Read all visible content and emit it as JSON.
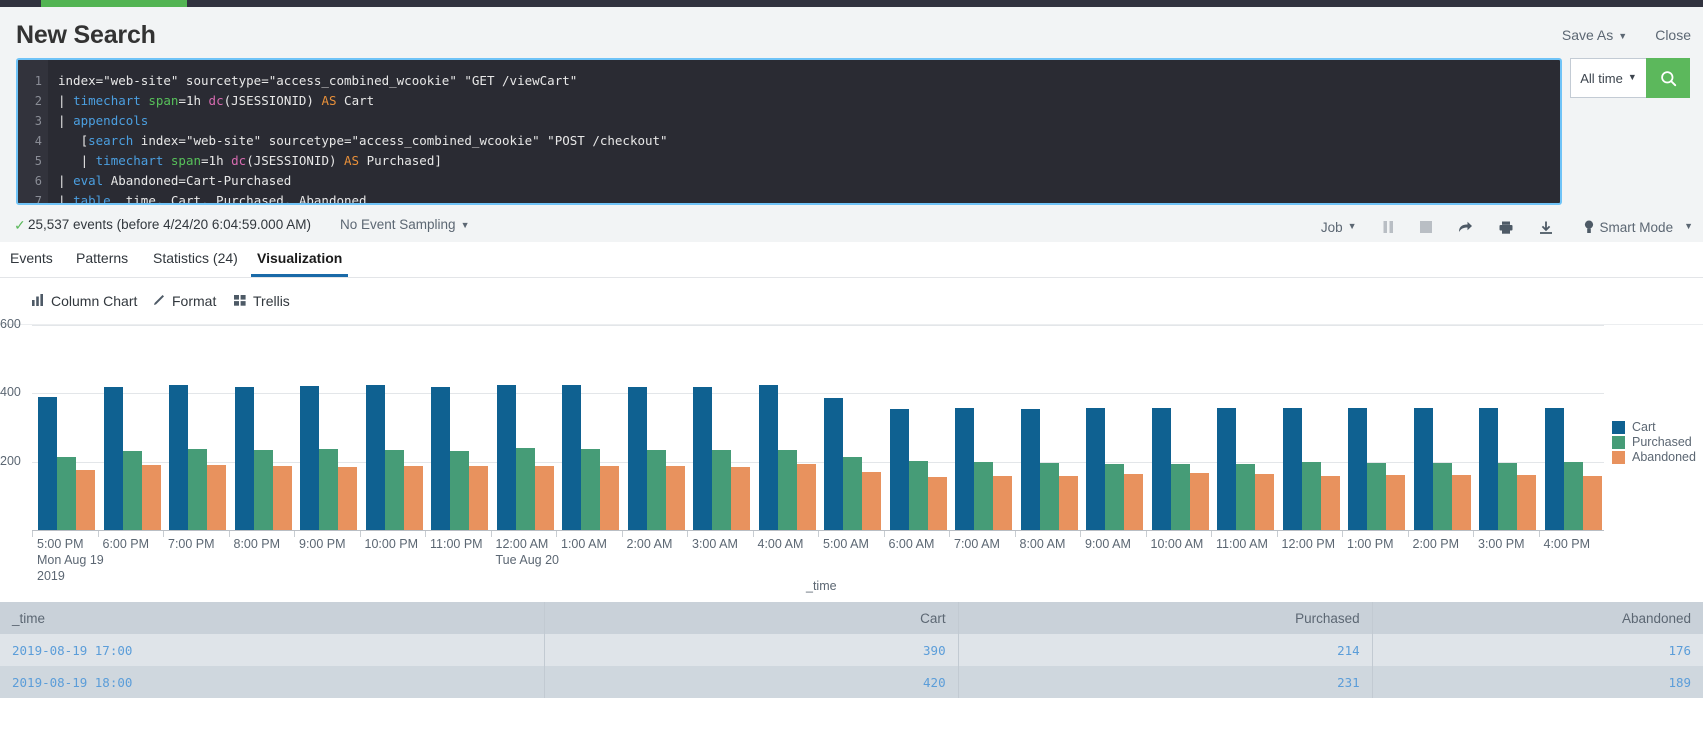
{
  "topbar": {
    "accent_color": "#53b453",
    "bar_color": "#31333f"
  },
  "header": {
    "title": "New Search",
    "save_as": "Save As",
    "close": "Close"
  },
  "search": {
    "time_range": "All time",
    "search_icon": "search-icon",
    "query_lines": [
      {
        "num": "1",
        "text": "index=\"web-site\" sourcetype=\"access_combined_wcookie\" \"GET /viewCart\""
      },
      {
        "num": "2",
        "text": "| timechart span=1h dc(JSESSIONID) AS Cart"
      },
      {
        "num": "3",
        "text": "| appendcols"
      },
      {
        "num": "4",
        "text": "   [search index=\"web-site\" sourcetype=\"access_combined_wcookie\" \"POST /checkout\""
      },
      {
        "num": "5",
        "text": "   | timechart span=1h dc(JSESSIONID) AS Purchased]"
      },
      {
        "num": "6",
        "text": "| eval Abandoned=Cart-Purchased"
      },
      {
        "num": "7",
        "text": "| table _time, Cart, Purchased, Abandoned"
      }
    ]
  },
  "status": {
    "check_icon": "checkmark-icon",
    "events_text": "25,537 events (before 4/24/20 6:04:59.000 AM)",
    "event_sampling": "No Event Sampling",
    "job": "Job",
    "pause_icon": "pause-icon",
    "stop_icon": "stop-icon",
    "share_icon": "share-icon",
    "print_icon": "print-icon",
    "export_icon": "export-icon",
    "mode_icon": "lightbulb-icon",
    "smart_mode": "Smart Mode"
  },
  "tabs": [
    {
      "label": "Events",
      "active": false
    },
    {
      "label": "Patterns",
      "active": false
    },
    {
      "label": "Statistics (24)",
      "active": false
    },
    {
      "label": "Visualization",
      "active": true
    }
  ],
  "viz_toolbar": [
    {
      "label": "Column Chart",
      "icon": "bar-chart-icon"
    },
    {
      "label": "Format",
      "icon": "pencil-icon"
    },
    {
      "label": "Trellis",
      "icon": "grid-icon"
    }
  ],
  "chart_data": {
    "type": "bar",
    "title": "",
    "xlabel": "_time",
    "ylabel": "",
    "ylim": [
      0,
      600
    ],
    "yticks": [
      200,
      400,
      600
    ],
    "grid": true,
    "legend_position": "right",
    "colors": {
      "Cart": "#0f6191",
      "Purchased": "#469c77",
      "Abandoned": "#e8925e"
    },
    "x_axis_notes": [
      {
        "index": 0,
        "line1": "Mon Aug 19",
        "line2": "2019"
      },
      {
        "index": 7,
        "line1": "Tue Aug 20",
        "line2": ""
      }
    ],
    "categories": [
      "5:00 PM",
      "6:00 PM",
      "7:00 PM",
      "8:00 PM",
      "9:00 PM",
      "10:00 PM",
      "11:00 PM",
      "12:00 AM",
      "1:00 AM",
      "2:00 AM",
      "3:00 AM",
      "4:00 AM",
      "5:00 AM",
      "6:00 AM",
      "7:00 AM",
      "8:00 AM",
      "9:00 AM",
      "10:00 AM",
      "11:00 AM",
      "12:00 PM",
      "1:00 PM",
      "2:00 PM",
      "3:00 PM",
      "4:00 PM"
    ],
    "series": [
      {
        "name": "Cart",
        "values": [
          390,
          420,
          423,
          420,
          421,
          423,
          418,
          425,
          423,
          420,
          420,
          425,
          385,
          355,
          357,
          353,
          357,
          358,
          358,
          357,
          357,
          358,
          358,
          357
        ]
      },
      {
        "name": "Purchased",
        "values": [
          214,
          231,
          236,
          234,
          236,
          235,
          232,
          239,
          236,
          234,
          235,
          233,
          215,
          201,
          198,
          196,
          194,
          192,
          194,
          198,
          196,
          196,
          196,
          199
        ]
      },
      {
        "name": "Abandoned",
        "values": [
          176,
          189,
          190,
          186,
          185,
          188,
          186,
          186,
          187,
          186,
          185,
          192,
          170,
          154,
          159,
          157,
          163,
          166,
          164,
          159,
          161,
          162,
          162,
          158
        ]
      }
    ]
  },
  "results_table": {
    "columns": [
      "_time",
      "Cart",
      "Purchased",
      "Abandoned"
    ],
    "rows": [
      {
        "_time": "2019-08-19 17:00",
        "Cart": "390",
        "Purchased": "214",
        "Abandoned": "176"
      },
      {
        "_time": "2019-08-19 18:00",
        "Cart": "420",
        "Purchased": "231",
        "Abandoned": "189"
      }
    ]
  }
}
